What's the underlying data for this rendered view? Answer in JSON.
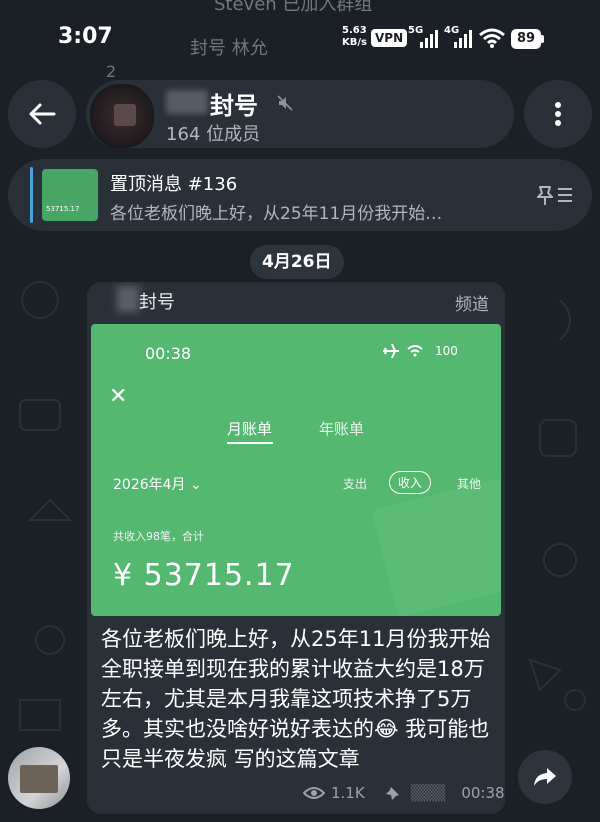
{
  "status_bar": {
    "time": "3:07",
    "faded_text": "Steven 已加入群组",
    "net_speed_value": "5.63",
    "net_speed_unit": "KB/s",
    "vpn": "VPN",
    "signal1": "5G",
    "signal2": "4G",
    "battery": "89"
  },
  "background": {
    "faded_row": "封号    林允",
    "faded_num": "2"
  },
  "header": {
    "channel_name": "封号",
    "member_count": "164 位成员"
  },
  "pinned": {
    "title": "置顶消息 #136",
    "preview": "各位老板们晚上好，从25年11月份我开始…",
    "thumb_amount": "53715.17"
  },
  "date_chip": "4月26日",
  "message": {
    "sender": "封号",
    "tag": "频道",
    "screenshot": {
      "time": "00:38",
      "battery": "100",
      "tab_active": "月账单",
      "tab_other": "年账单",
      "month": "2026年4月",
      "filter_out": "支出",
      "filter_in": "收入",
      "filter_other": "其他",
      "summary": "共收入98笔，合计",
      "amount": "¥ 53715.17"
    },
    "text": "各位老板们晚上好，从25年11月份我开始全职接单到现在我的累计收益大约是18万左右，尤其是本月我靠这项技术挣了5万多。其实也没啥好说好表达的😂 我可能也只是半夜发疯 写的这篇文章",
    "views": "1.1K",
    "time": "00:38"
  }
}
